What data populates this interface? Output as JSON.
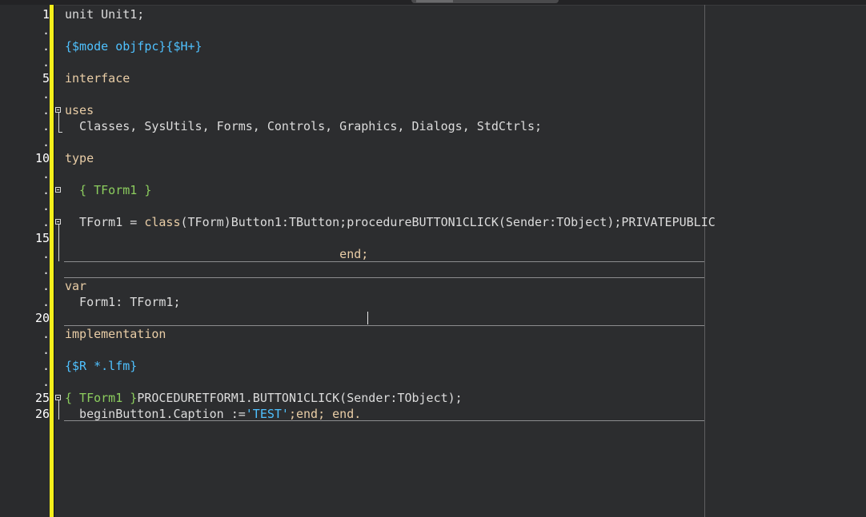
{
  "gutter": {
    "line_markers": [
      "1",
      ".",
      ".",
      ".",
      "5",
      ".",
      ".",
      ".",
      ".",
      "10",
      ".",
      ".",
      ".",
      ".",
      "15",
      ".",
      ".",
      ".",
      ".",
      "20",
      ".",
      ".",
      ".",
      ".",
      "25",
      "26"
    ]
  },
  "code": {
    "line1": "unit Unit1;",
    "line3": "{$mode objfpc}{$H+}",
    "line5": "interface",
    "line7": "uses",
    "line8": "  Classes, SysUtils, Forms, Controls, Graphics, Dialogs, StdCtrls;",
    "line10": "type",
    "line12": "  { TForm1 }",
    "line14_a": "  TForm1 = ",
    "line14_b": "class",
    "line14_c": "(TForm)Button1:TButton;procedureBUTTON1CLICK(Sender:TObject);PRIVATEPUBLIC",
    "line16": "                                      end;",
    "line18": "var",
    "line19": "  Form1: TForm1;",
    "line21": "implementation",
    "line23": "{$R *.lfm}",
    "line25_a": "{ TForm1 }",
    "line25_b": "PROCEDURETFORM1.BUTTON1CLICK(Sender:TObject);",
    "line26_a": "  beginButton1.Caption :=",
    "line26_b": "'TEST'",
    "line26_c": ";end; end."
  },
  "colors": {
    "background": "#2c2d2f",
    "changebar": "#f4ef1b",
    "keyword": "#e9cda6",
    "directive": "#4fc1ff",
    "comment": "#8ccd5e",
    "string": "#4fc1ff"
  }
}
